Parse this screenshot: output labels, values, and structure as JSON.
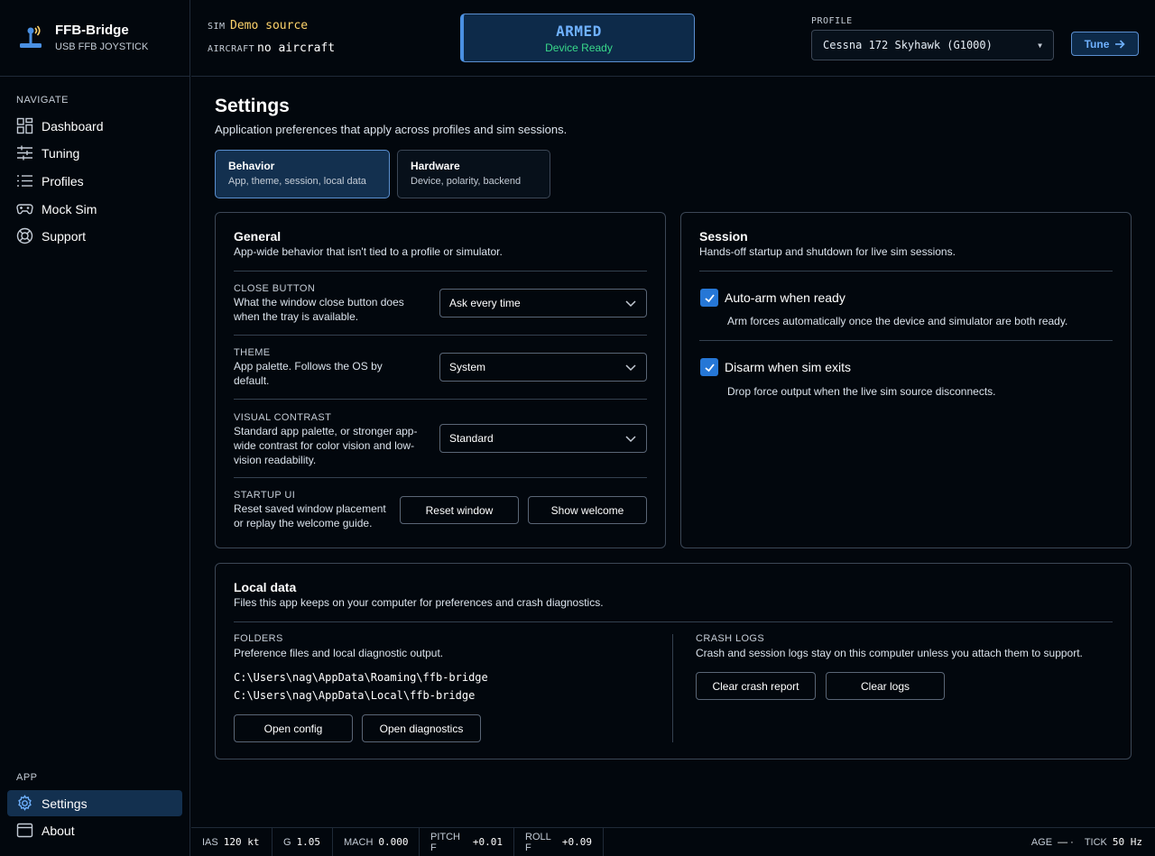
{
  "brand": {
    "name": "FFB-Bridge",
    "subtitle": "USB FFB JOYSTICK"
  },
  "nav": {
    "heading": "NAVIGATE",
    "items": [
      {
        "label": "Dashboard",
        "icon": "dashboard-icon"
      },
      {
        "label": "Tuning",
        "icon": "sliders-icon"
      },
      {
        "label": "Profiles",
        "icon": "list-icon"
      },
      {
        "label": "Mock Sim",
        "icon": "gamepad-icon"
      },
      {
        "label": "Support",
        "icon": "lifebuoy-icon"
      }
    ],
    "app_heading": "APP",
    "app_items": [
      {
        "label": "Settings",
        "icon": "gear-icon",
        "active": true
      },
      {
        "label": "About",
        "icon": "window-icon"
      }
    ]
  },
  "header": {
    "sim_label": "SIM",
    "sim_value": "Demo source",
    "aircraft_label": "AIRCRAFT",
    "aircraft_value": "no aircraft",
    "armed_title": "ARMED",
    "armed_status": "Device Ready",
    "profile_label": "PROFILE",
    "profile_value": "Cessna 172 Skyhawk (G1000)",
    "tune_label": "Tune"
  },
  "page": {
    "title": "Settings",
    "subtitle": "Application preferences that apply across profiles and sim sessions.",
    "tabs": [
      {
        "label": "Behavior",
        "sub": "App, theme, session, local data",
        "active": true
      },
      {
        "label": "Hardware",
        "sub": "Device, polarity, backend",
        "active": false
      }
    ]
  },
  "general": {
    "title": "General",
    "desc": "App-wide behavior that isn't tied to a profile or simulator.",
    "close_button": {
      "key": "CLOSE BUTTON",
      "desc": "What the window close button does when the tray is available.",
      "value": "Ask every time"
    },
    "theme": {
      "key": "THEME",
      "desc": "App palette. Follows the OS by default.",
      "value": "System"
    },
    "contrast": {
      "key": "VISUAL CONTRAST",
      "desc": "Standard app palette, or stronger app-wide contrast for color vision and low-vision readability.",
      "value": "Standard"
    },
    "startup": {
      "key": "STARTUP UI",
      "desc": "Reset saved window placement or replay the welcome guide.",
      "reset_label": "Reset window",
      "welcome_label": "Show welcome"
    }
  },
  "session": {
    "title": "Session",
    "desc": "Hands-off startup and shutdown for live sim sessions.",
    "auto_arm": {
      "label": "Auto-arm when ready",
      "desc": "Arm forces automatically once the device and simulator are both ready.",
      "checked": true
    },
    "disarm": {
      "label": "Disarm when sim exits",
      "desc": "Drop force output when the live sim source disconnects.",
      "checked": true
    }
  },
  "local_data": {
    "title": "Local data",
    "desc": "Files this app keeps on your computer for preferences and crash diagnostics.",
    "folders_key": "FOLDERS",
    "folders_desc": "Preference files and local diagnostic output.",
    "path_roaming": "C:\\Users\\nag\\AppData\\Roaming\\ffb-bridge",
    "path_local": "C:\\Users\\nag\\AppData\\Local\\ffb-bridge",
    "open_config_label": "Open config",
    "open_diag_label": "Open diagnostics",
    "crash_key": "CRASH LOGS",
    "crash_desc": "Crash and session logs stay on this computer unless you attach them to support.",
    "clear_crash_label": "Clear crash report",
    "clear_logs_label": "Clear logs"
  },
  "statusbar": {
    "ias_k": "IAS",
    "ias_v": "120 kt",
    "g_k": "G",
    "g_v": "1.05",
    "mach_k": "MACH",
    "mach_v": "0.000",
    "pitch_k": "PITCH F",
    "pitch_v": "+0.01",
    "roll_k": "ROLL F",
    "roll_v": "+0.09",
    "age_k": "AGE",
    "age_v": "— ·",
    "tick_k": "TICK",
    "tick_v": "50 Hz"
  },
  "colors": {
    "accent": "#2677d6",
    "armed_text": "#6fb1ff",
    "ready_text": "#39d98a",
    "sim_value": "#ffd36b"
  }
}
